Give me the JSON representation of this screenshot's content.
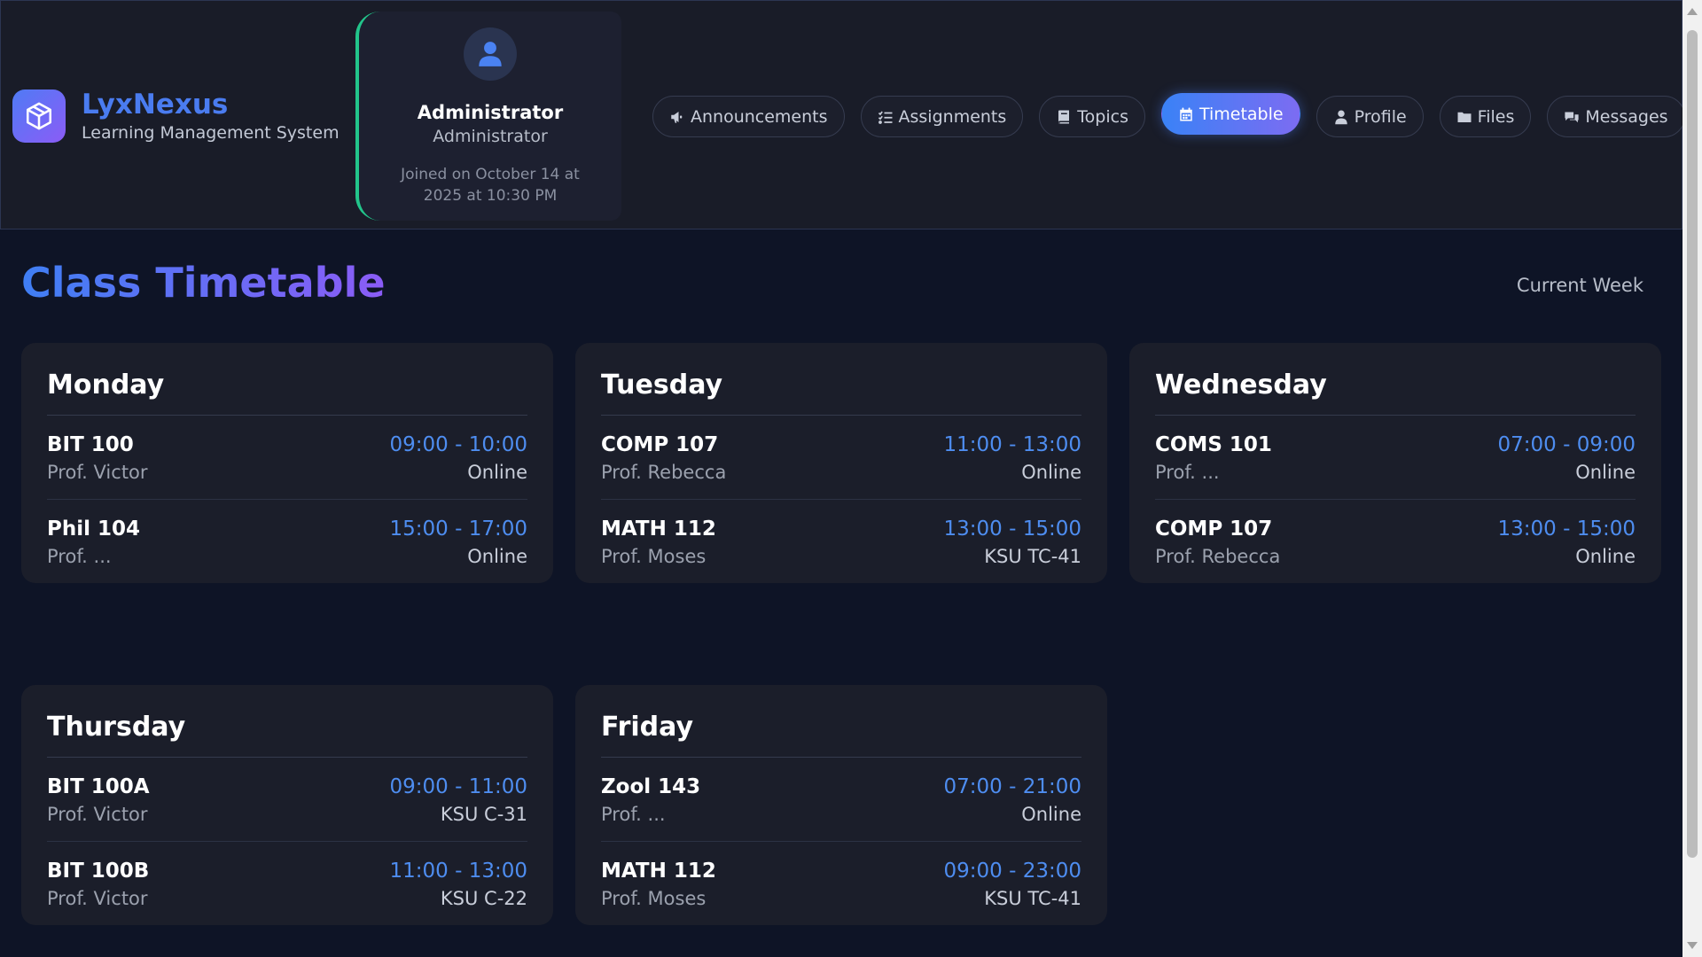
{
  "brand": {
    "name": "LyxNexus",
    "subtitle": "Learning Management System"
  },
  "profile": {
    "name": "Administrator",
    "role": "Administrator",
    "joined": "Joined on October 14 at 2025 at 10:30 PM"
  },
  "nav": [
    {
      "label": "Announcements",
      "icon": "megaphone-icon"
    },
    {
      "label": "Assignments",
      "icon": "list-check-icon"
    },
    {
      "label": "Topics",
      "icon": "book-icon"
    },
    {
      "label": "Timetable",
      "icon": "calendar-icon",
      "active": true
    },
    {
      "label": "Profile",
      "icon": "user-icon"
    },
    {
      "label": "Files",
      "icon": "folder-icon"
    },
    {
      "label": "Messages",
      "icon": "chat-icon"
    }
  ],
  "page": {
    "title": "Class Timetable",
    "week_label": "Current Week"
  },
  "days": [
    {
      "name": "Monday",
      "sessions": [
        {
          "course": "BIT 100",
          "professor": "Prof. Victor",
          "time": "09:00 - 10:00",
          "location": "Online"
        },
        {
          "course": "Phil 104",
          "professor": "Prof. ...",
          "time": "15:00 - 17:00",
          "location": "Online"
        }
      ]
    },
    {
      "name": "Tuesday",
      "sessions": [
        {
          "course": "COMP 107",
          "professor": "Prof. Rebecca",
          "time": "11:00 - 13:00",
          "location": "Online"
        },
        {
          "course": "MATH 112",
          "professor": "Prof. Moses",
          "time": "13:00 - 15:00",
          "location": "KSU TC-41"
        }
      ]
    },
    {
      "name": "Wednesday",
      "sessions": [
        {
          "course": "COMS 101",
          "professor": "Prof. ...",
          "time": "07:00 - 09:00",
          "location": "Online"
        },
        {
          "course": "COMP 107",
          "professor": "Prof. Rebecca",
          "time": "13:00 - 15:00",
          "location": "Online"
        }
      ]
    },
    {
      "name": "Thursday",
      "sessions": [
        {
          "course": "BIT 100A",
          "professor": "Prof. Victor",
          "time": "09:00 - 11:00",
          "location": "KSU C-31"
        },
        {
          "course": "BIT 100B",
          "professor": "Prof. Victor",
          "time": "11:00 - 13:00",
          "location": "KSU C-22"
        }
      ]
    },
    {
      "name": "Friday",
      "sessions": [
        {
          "course": "Zool 143",
          "professor": "Prof. ...",
          "time": "07:00 - 21:00",
          "location": "Online"
        },
        {
          "course": "MATH 112",
          "professor": "Prof. Moses",
          "time": "09:00 - 23:00",
          "location": "KSU TC-41"
        }
      ]
    }
  ],
  "colors": {
    "accent": "#4a7cf0",
    "accent2": "#8b5cf6",
    "time": "#4e8df0",
    "profile_border": "#22c58b"
  }
}
